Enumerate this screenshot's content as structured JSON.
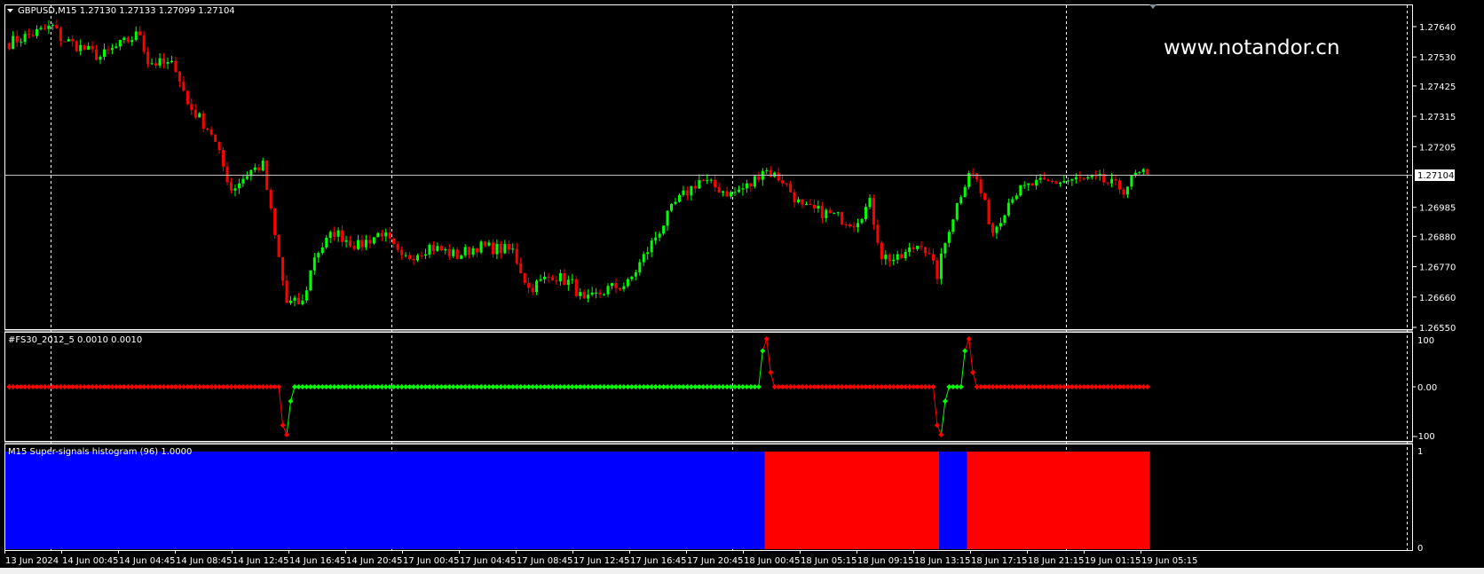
{
  "window": {
    "symbol_header": "GBPUSD,M15  1.27130 1.27133 1.27099 1.27104",
    "watermark": "www.notandor.cn"
  },
  "colors": {
    "bull": "#00ff00",
    "bear": "#ff0000",
    "hist_blue": "#0000ff",
    "hist_red": "#ff0000",
    "grid": "#ffffff",
    "price_line": "#c0c0c0"
  },
  "price_axis": {
    "ticks": [
      "1.27640",
      "1.27530",
      "1.27425",
      "1.27315",
      "1.27205",
      "1.26985",
      "1.26880",
      "1.26770",
      "1.26660",
      "1.26550"
    ],
    "current_price": "1.27104"
  },
  "indicator": {
    "title": "#FS30_2012_5 0.0010 0.0010",
    "ticks": [
      "100",
      "0.00",
      "-100"
    ]
  },
  "histogram": {
    "title": "M15 Super-signals histogram (96) 1.0000",
    "ticks": [
      "1",
      "0"
    ]
  },
  "time_axis": {
    "labels": [
      "13 Jun 2024",
      "14 Jun 00:45",
      "14 Jun 04:45",
      "14 Jun 08:45",
      "14 Jun 12:45",
      "14 Jun 16:45",
      "14 Jun 20:45",
      "17 Jun 00:45",
      "17 Jun 04:45",
      "17 Jun 08:45",
      "17 Jun 12:45",
      "17 Jun 16:45",
      "17 Jun 20:45",
      "18 Jun 00:45",
      "18 Jun 05:15",
      "18 Jun 09:15",
      "18 Jun 13:15",
      "18 Jun 17:15",
      "18 Jun 21:15",
      "19 Jun 01:15",
      "19 Jun 05:15"
    ]
  },
  "chart_data": {
    "type": "candlestick",
    "bars": 288,
    "price_range": [
      1.2655,
      1.2764
    ],
    "close_anchors": [
      [
        0,
        1.27582
      ],
      [
        11,
        1.2764
      ],
      [
        13,
        1.27599
      ],
      [
        23,
        1.2753
      ],
      [
        33,
        1.27616
      ],
      [
        35,
        1.27513
      ],
      [
        42,
        1.27496
      ],
      [
        45,
        1.27359
      ],
      [
        51,
        1.27256
      ],
      [
        56,
        1.2705
      ],
      [
        61,
        1.27119
      ],
      [
        64,
        1.27136
      ],
      [
        67,
        1.26879
      ],
      [
        70,
        1.26638
      ],
      [
        74,
        1.26638
      ],
      [
        77,
        1.2681
      ],
      [
        82,
        1.26896
      ],
      [
        88,
        1.26844
      ],
      [
        94,
        1.26896
      ],
      [
        99,
        1.26793
      ],
      [
        106,
        1.26844
      ],
      [
        113,
        1.2681
      ],
      [
        118,
        1.26844
      ],
      [
        127,
        1.26827
      ],
      [
        131,
        1.2669
      ],
      [
        137,
        1.26741
      ],
      [
        142,
        1.26707
      ],
      [
        145,
        1.26638
      ],
      [
        151,
        1.2669
      ],
      [
        156,
        1.26707
      ],
      [
        163,
        1.26879
      ],
      [
        168,
        1.26999
      ],
      [
        174,
        1.27084
      ],
      [
        182,
        1.27033
      ],
      [
        187,
        1.27067
      ],
      [
        190,
        1.27126
      ],
      [
        195,
        1.27084
      ],
      [
        200,
        1.26981
      ],
      [
        206,
        1.26964
      ],
      [
        213,
        1.2693
      ],
      [
        217,
        1.26999
      ],
      [
        220,
        1.2681
      ],
      [
        224,
        1.26793
      ],
      [
        230,
        1.26861
      ],
      [
        234,
        1.26741
      ],
      [
        237,
        1.26913
      ],
      [
        242,
        1.27119
      ],
      [
        244,
        1.27084
      ],
      [
        248,
        1.26896
      ],
      [
        253,
        1.27033
      ],
      [
        258,
        1.27067
      ],
      [
        268,
        1.27084
      ],
      [
        275,
        1.27084
      ],
      [
        281,
        1.2705
      ],
      [
        284,
        1.27101
      ],
      [
        287,
        1.27104
      ]
    ],
    "indicator_runs": [
      [
        0,
        68,
        0,
        "red"
      ],
      [
        69,
        69,
        -80,
        "red"
      ],
      [
        70,
        70,
        -100,
        "red"
      ],
      [
        71,
        71,
        -30,
        "green"
      ],
      [
        72,
        189,
        0,
        "green"
      ],
      [
        190,
        190,
        75,
        "green"
      ],
      [
        191,
        191,
        100,
        "red"
      ],
      [
        192,
        192,
        30,
        "red"
      ],
      [
        193,
        233,
        0,
        "red"
      ],
      [
        234,
        234,
        -80,
        "red"
      ],
      [
        235,
        235,
        -100,
        "red"
      ],
      [
        236,
        236,
        -30,
        "green"
      ],
      [
        237,
        240,
        0,
        "green"
      ],
      [
        241,
        241,
        75,
        "green"
      ],
      [
        242,
        242,
        100,
        "red"
      ],
      [
        243,
        243,
        30,
        "red"
      ],
      [
        244,
        287,
        0,
        "red"
      ]
    ],
    "indicator_range": [
      -100,
      100
    ],
    "histogram_runs": [
      [
        0,
        190,
        1,
        "blue"
      ],
      [
        191,
        234,
        1,
        "red"
      ],
      [
        235,
        241,
        1,
        "blue"
      ],
      [
        242,
        287,
        1,
        "red"
      ]
    ]
  }
}
